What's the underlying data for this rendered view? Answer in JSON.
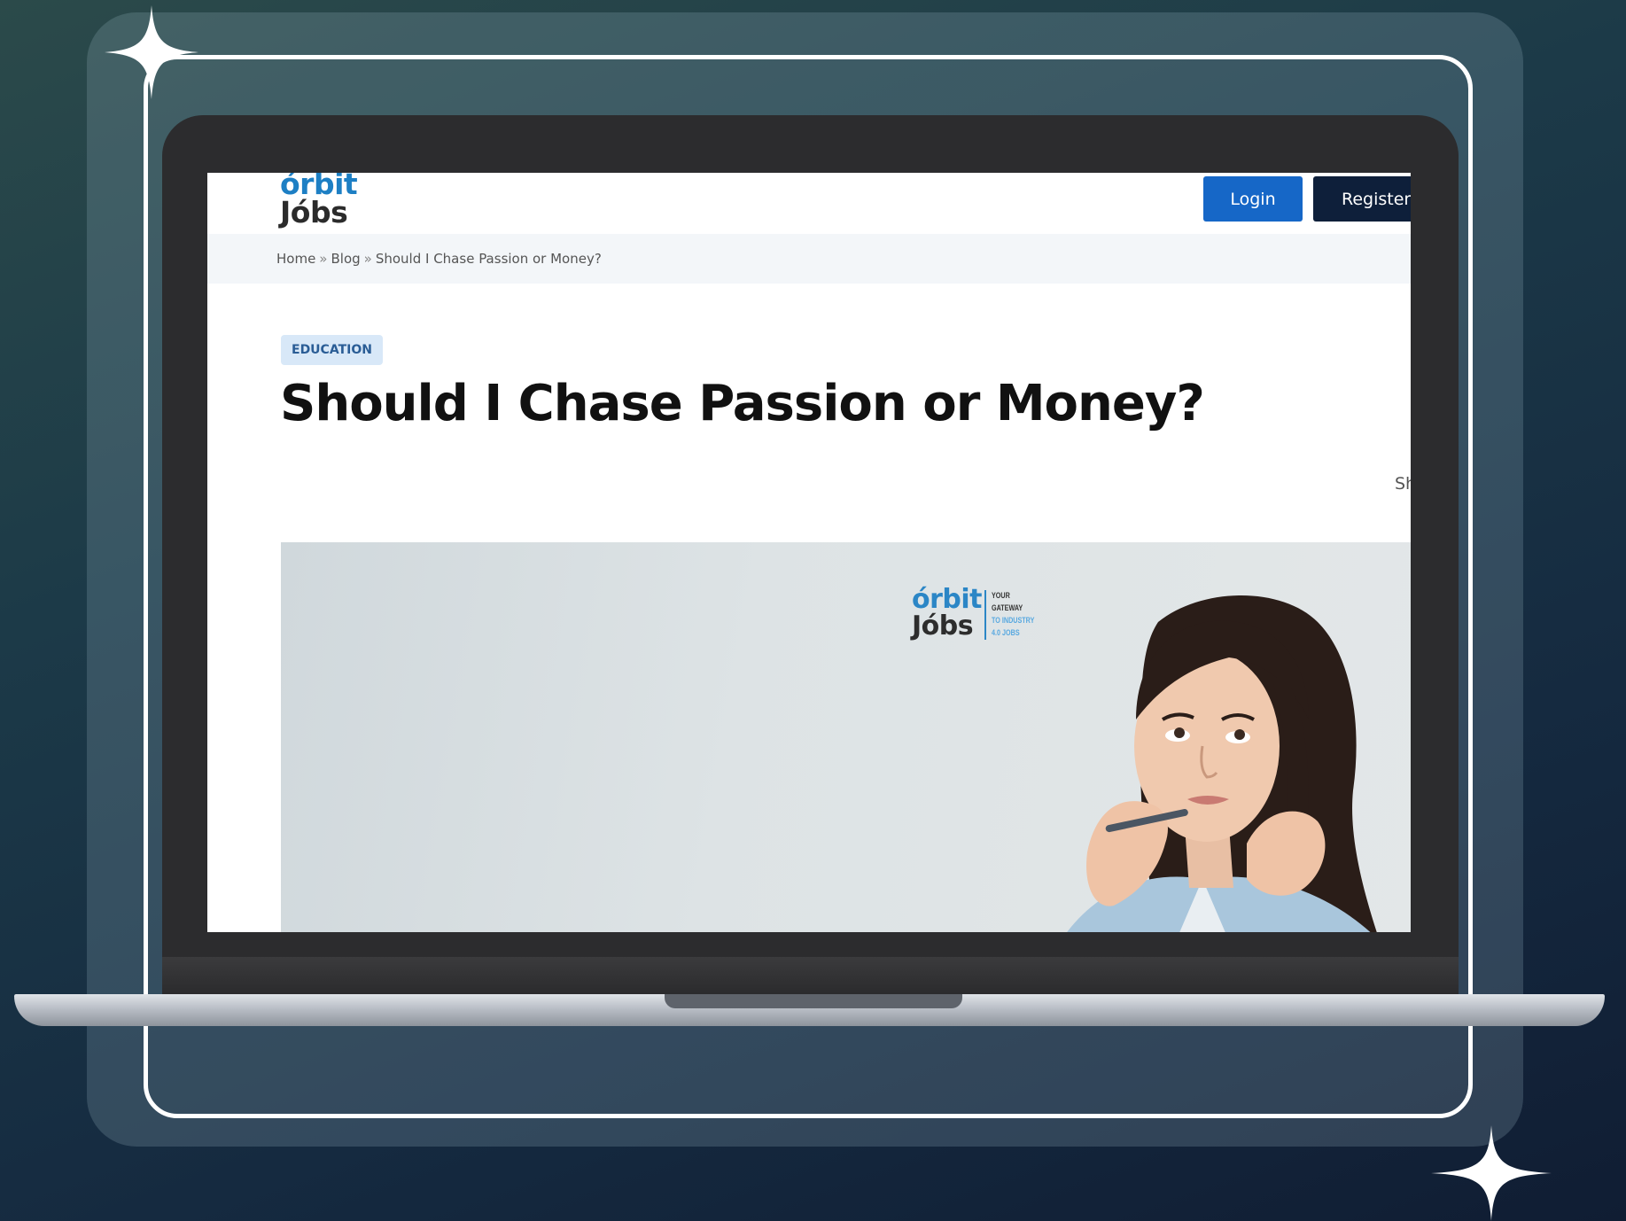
{
  "header": {
    "logo_line1": "órbit",
    "logo_line2": "Jóbs",
    "login_label": "Login",
    "register_label": "Register"
  },
  "breadcrumb": {
    "items": [
      "Home",
      "Blog",
      "Should I Chase Passion or Money?"
    ],
    "separator": "»"
  },
  "article": {
    "category": "EDUCATION",
    "title": "Should I Chase Passion or Money?",
    "share_label": "Sh"
  },
  "hero": {
    "logo_line1": "órbit",
    "logo_line2": "Jóbs",
    "tagline": [
      "YOUR",
      "GATEWAY",
      "TO INDUSTRY",
      "4.0 JOBS"
    ]
  },
  "colors": {
    "login_button": "#1667c7",
    "register_button": "#0e1f3a",
    "badge_bg": "#d8e8f8",
    "badge_text": "#2a5d96",
    "logo_blue": "#1d7fc4"
  },
  "icons": [
    "sparkle-icon",
    "sparkle-icon"
  ]
}
